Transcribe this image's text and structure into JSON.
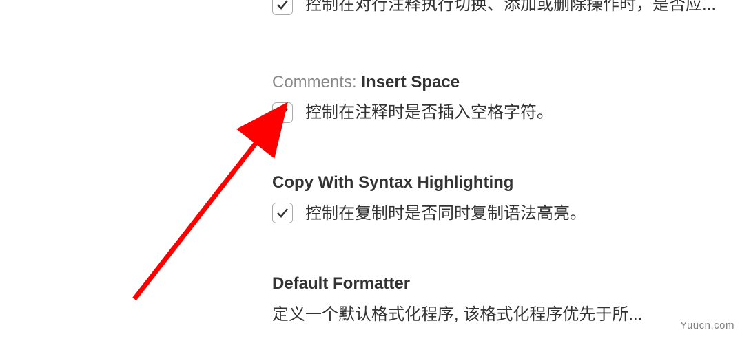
{
  "settings": {
    "partial_top": {
      "checked": true,
      "description": "控制在对行注释执行切换、添加或删除操作时，是否应..."
    },
    "insert_space": {
      "prefix": "Comments: ",
      "name": "Insert Space",
      "checked": true,
      "description": "控制在注释时是否插入空格字符。"
    },
    "copy_syntax": {
      "name": "Copy With Syntax Highlighting",
      "checked": true,
      "description": "控制在复制时是否同时复制语法高亮。"
    },
    "default_formatter": {
      "name": "Default Formatter",
      "description": "定义一个默认格式化程序, 该格式化程序优先于所..."
    }
  },
  "watermark": "Yuucn.com"
}
